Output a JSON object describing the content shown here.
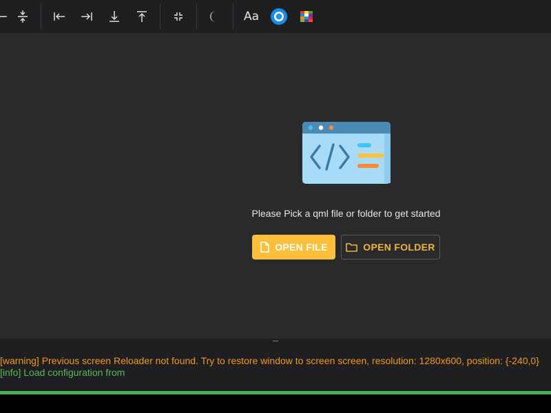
{
  "toolbar": {
    "buttons": [
      {
        "name": "align-horizontal-edge-icon"
      },
      {
        "name": "align-vertical-center-icon"
      },
      {
        "name": "align-left-edge-icon"
      },
      {
        "name": "align-right-edge-icon"
      },
      {
        "name": "align-bottom-edge-icon"
      },
      {
        "name": "align-top-edge-icon"
      },
      {
        "name": "collapse-icon"
      },
      {
        "name": "dark-mode-icon"
      },
      {
        "name": "font-size-icon",
        "label": "Aa"
      },
      {
        "name": "color-picker-icon"
      },
      {
        "name": "palette-icon"
      }
    ],
    "font_label": "Aa"
  },
  "main": {
    "illustration_icon": "code-window-icon",
    "prompt": "Please Pick a qml file or folder to get started",
    "open_file_label": "OPEN FILE",
    "open_folder_label": "OPEN FOLDER",
    "accent_color": "#fbbf3a"
  },
  "console": {
    "lines": [
      {
        "level": "warning",
        "text": "[warning] Previous screen Reloader not found. Try to restore window to screen screen, resolution: 1280x600, position: {-240,0}"
      },
      {
        "level": "info",
        "text": "[info] Load configuration from"
      }
    ],
    "warning_color": "#f39a1e",
    "info_color": "#5cb85c"
  },
  "status": {
    "progress_color": "#4caf50",
    "progress_value": 1.0
  }
}
